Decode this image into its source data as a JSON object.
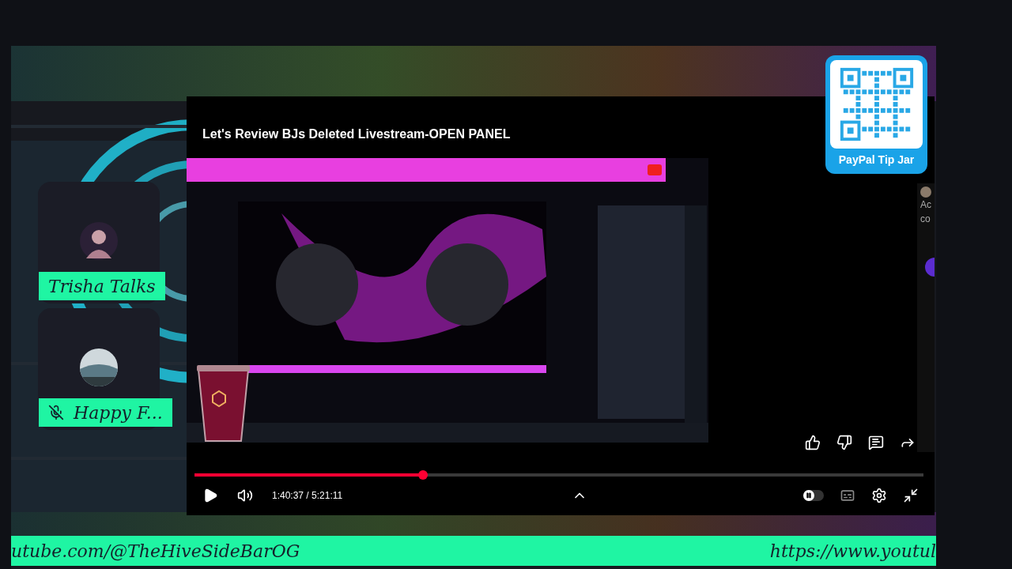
{
  "player": {
    "title": "Let's Review BJs Deleted Livestream-OPEN PANEL",
    "progress": {
      "level": 0.313
    },
    "time": "1:40:37 / 5:21:11",
    "autoplay": {
      "on": false
    },
    "side_texts": [
      "Ac",
      "co"
    ]
  },
  "participants": [
    {
      "name": "Trisha Talks",
      "muted": false,
      "kind": "person"
    },
    {
      "name": "Happy F...",
      "muted": true,
      "kind": "landscape"
    }
  ],
  "tip_jar": {
    "label": "PayPal Tip Jar"
  },
  "ticker": {
    "left": "utube.com/@TheHiveSideBarOG",
    "right": "https://www.youtul"
  }
}
